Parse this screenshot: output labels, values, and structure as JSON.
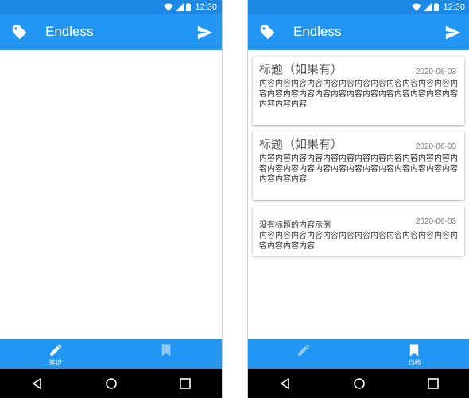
{
  "status": {
    "time": "12:30"
  },
  "colors": {
    "primary": "#2196f3",
    "status_bar": "#1e88e5",
    "nav_bg": "#000000"
  },
  "toolbar": {
    "title": "Endless",
    "left_icon": "tag-icon",
    "right_icon": "send-icon"
  },
  "left_screen": {
    "bottom_nav": [
      {
        "icon": "pencil-icon",
        "label": "笔记",
        "active": true
      },
      {
        "icon": "bookmark-icon",
        "label": "",
        "active": false
      }
    ]
  },
  "right_screen": {
    "cards": [
      {
        "title": "标题（如果有）",
        "date": "2020-06-03",
        "body": "内容内容内容内容内容内容内容内容内容内容内容内容内容内容内容内容内容内容内容内容内容内容内容内容内容内容内容内容"
      },
      {
        "title": "标题（如果有）",
        "date": "2020-06-03",
        "body": "内容内容内容内容内容内容内容内容内容内容内容内容内容内容内容内容内容内容内容内容内容内容内容内容内容内容内容内容"
      },
      {
        "title": "",
        "date": "2020-06-03",
        "subtitle": "没有标题的内容示例",
        "body": "内容内容内容内容内容内容内容内容内容内容内容内容内容内容内容内容"
      }
    ],
    "bottom_nav": [
      {
        "icon": "pencil-icon",
        "label": "",
        "active": false
      },
      {
        "icon": "bookmark-icon",
        "label": "归档",
        "active": true
      }
    ]
  },
  "system_nav": {
    "back": "back-icon",
    "home": "home-icon",
    "recents": "recents-icon"
  }
}
